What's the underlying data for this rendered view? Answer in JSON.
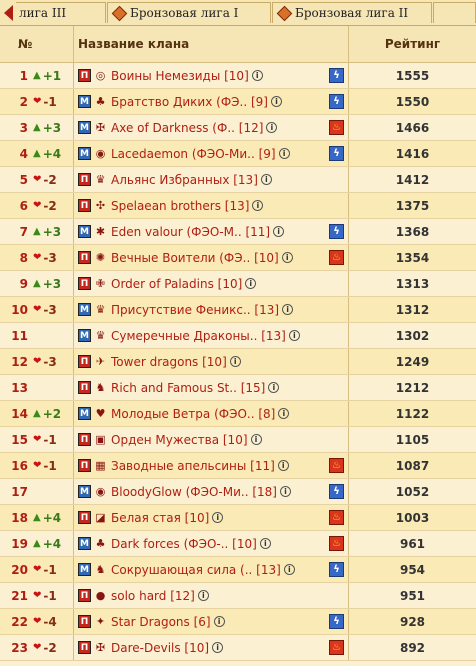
{
  "tabs": [
    {
      "label": "лига III"
    },
    {
      "label": "Бронзовая лига I"
    },
    {
      "label": "Бронзовая лига II"
    }
  ],
  "header": {
    "no": "№",
    "name": "Название клана",
    "rating": "Рейтинг"
  },
  "rows": [
    {
      "rank": "1",
      "dir": "up",
      "change": "+1",
      "clan": "Воины Немезиды [10]",
      "rating": "1555",
      "element": "water",
      "element_icon": "lightning-icon",
      "badge": "П",
      "emblem": "◎"
    },
    {
      "rank": "2",
      "dir": "down",
      "change": "-1",
      "clan": "Братство Диких (ФЭ.. [9]",
      "rating": "1550",
      "element": "water",
      "element_icon": "lightning-icon",
      "badge": "М",
      "emblem": "♣"
    },
    {
      "rank": "3",
      "dir": "up",
      "change": "+3",
      "clan": "Axe of Darkness (Ф.. [12]",
      "rating": "1466",
      "element": "fire",
      "element_icon": "flame-icon",
      "badge": "М",
      "emblem": "✠"
    },
    {
      "rank": "4",
      "dir": "up",
      "change": "+4",
      "clan": "Lacedaemon (ФЭО-Ми.. [9]",
      "rating": "1416",
      "element": "water",
      "element_icon": "lightning-icon",
      "badge": "М",
      "emblem": "◉"
    },
    {
      "rank": "5",
      "dir": "down",
      "change": "-2",
      "clan": "Альянс Избранных [13]",
      "rating": "1412",
      "element": "",
      "element_icon": "",
      "badge": "П",
      "emblem": "♛"
    },
    {
      "rank": "6",
      "dir": "down",
      "change": "-2",
      "clan": "Spelaean brothers [13]",
      "rating": "1375",
      "element": "",
      "element_icon": "",
      "badge": "П",
      "emblem": "✣"
    },
    {
      "rank": "7",
      "dir": "up",
      "change": "+3",
      "clan": "Eden valour (ФЭО-М.. [11]",
      "rating": "1368",
      "element": "water",
      "element_icon": "lightning-icon",
      "badge": "М",
      "emblem": "✱"
    },
    {
      "rank": "8",
      "dir": "down",
      "change": "-3",
      "clan": "Вечные Воители (ФЭ.. [10]",
      "rating": "1354",
      "element": "fire",
      "element_icon": "flame-icon",
      "badge": "П",
      "emblem": "✺"
    },
    {
      "rank": "9",
      "dir": "up",
      "change": "+3",
      "clan": "Order of Paladins [10]",
      "rating": "1313",
      "element": "",
      "element_icon": "",
      "badge": "П",
      "emblem": "✙"
    },
    {
      "rank": "10",
      "dir": "down",
      "change": "-3",
      "clan": "Присутствие Феникс.. [13]",
      "rating": "1312",
      "element": "",
      "element_icon": "",
      "badge": "М",
      "emblem": "♛"
    },
    {
      "rank": "11",
      "dir": "",
      "change": "",
      "clan": "Сумеречные Драконы.. [13]",
      "rating": "1302",
      "element": "",
      "element_icon": "",
      "badge": "М",
      "emblem": "♛"
    },
    {
      "rank": "12",
      "dir": "down",
      "change": "-3",
      "clan": "Tower dragons [10]",
      "rating": "1249",
      "element": "",
      "element_icon": "",
      "badge": "П",
      "emblem": "✈"
    },
    {
      "rank": "13",
      "dir": "",
      "change": "",
      "clan": "Rich and Famous St.. [15]",
      "rating": "1212",
      "element": "",
      "element_icon": "",
      "badge": "П",
      "emblem": "♞"
    },
    {
      "rank": "14",
      "dir": "up",
      "change": "+2",
      "clan": "Молодые Ветра (ФЭО.. [8]",
      "rating": "1122",
      "element": "",
      "element_icon": "",
      "badge": "М",
      "emblem": "♥"
    },
    {
      "rank": "15",
      "dir": "down",
      "change": "-1",
      "clan": "Орден Мужества [10]",
      "rating": "1105",
      "element": "",
      "element_icon": "",
      "badge": "П",
      "emblem": "▣"
    },
    {
      "rank": "16",
      "dir": "down",
      "change": "-1",
      "clan": "Заводные апельсины [11]",
      "rating": "1087",
      "element": "fire",
      "element_icon": "flame-icon",
      "badge": "П",
      "emblem": "▦"
    },
    {
      "rank": "17",
      "dir": "",
      "change": "",
      "clan": "BloodyGlow (ФЭО-Ми.. [18]",
      "rating": "1052",
      "element": "water",
      "element_icon": "lightning-icon",
      "badge": "М",
      "emblem": "◉"
    },
    {
      "rank": "18",
      "dir": "up",
      "change": "+4",
      "clan": "Белая стая [10]",
      "rating": "1003",
      "element": "fire",
      "element_icon": "flame-icon",
      "badge": "П",
      "emblem": "◪"
    },
    {
      "rank": "19",
      "dir": "up",
      "change": "+4",
      "clan": "Dark forces (ФЭО-.. [10]",
      "rating": "961",
      "element": "fire",
      "element_icon": "flame-icon",
      "badge": "М",
      "emblem": "♣"
    },
    {
      "rank": "20",
      "dir": "down",
      "change": "-1",
      "clan": "Сокрушающая сила (.. [13]",
      "rating": "954",
      "element": "water",
      "element_icon": "lightning-icon",
      "badge": "М",
      "emblem": "♞"
    },
    {
      "rank": "21",
      "dir": "down",
      "change": "-1",
      "clan": "solo hard [12]",
      "rating": "951",
      "element": "",
      "element_icon": "",
      "badge": "П",
      "emblem": "●"
    },
    {
      "rank": "22",
      "dir": "down",
      "change": "-4",
      "clan": "Star Dragons [6]",
      "rating": "928",
      "element": "water",
      "element_icon": "lightning-icon",
      "badge": "П",
      "emblem": "✦"
    },
    {
      "rank": "23",
      "dir": "down",
      "change": "-2",
      "clan": "Dare-Devils [10]",
      "rating": "892",
      "element": "fire",
      "element_icon": "flame-icon",
      "badge": "П",
      "emblem": "✠"
    }
  ],
  "info_glyph": "i",
  "colors": {
    "accent_red": "#b01e12",
    "up_green": "#3a8a1a",
    "down_red": "#cc1111",
    "water_blue": "#3568c7",
    "fire_red": "#d8351b"
  }
}
